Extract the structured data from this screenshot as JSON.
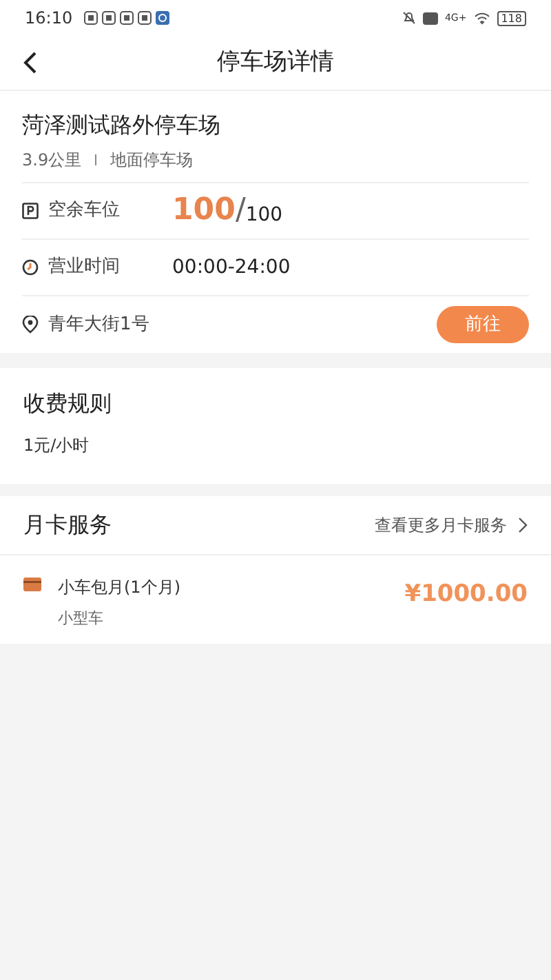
{
  "status_bar": {
    "time": "16:10",
    "network": "4G+",
    "battery": "118"
  },
  "header": {
    "title": "停车场详情"
  },
  "lot": {
    "name": "菏泽测试路外停车场",
    "distance": "3.9公里",
    "type": "地面停车场",
    "rows": [
      {
        "kind": "spaces",
        "label": "空余车位",
        "free": "100",
        "sep": "/",
        "total": "100"
      },
      {
        "kind": "hours",
        "label": "营业时间",
        "value": "00:00-24:00"
      },
      {
        "kind": "address",
        "label": "青年大街1号",
        "button": "前往"
      }
    ]
  },
  "fees": {
    "title": "收费规则",
    "rule": "1元/小时"
  },
  "monthly": {
    "title": "月卡服务",
    "more": "查看更多月卡服务",
    "items": [
      {
        "name": "小车包月(1个月)",
        "vehicle": "小型车",
        "price": "¥1000.00"
      }
    ]
  }
}
